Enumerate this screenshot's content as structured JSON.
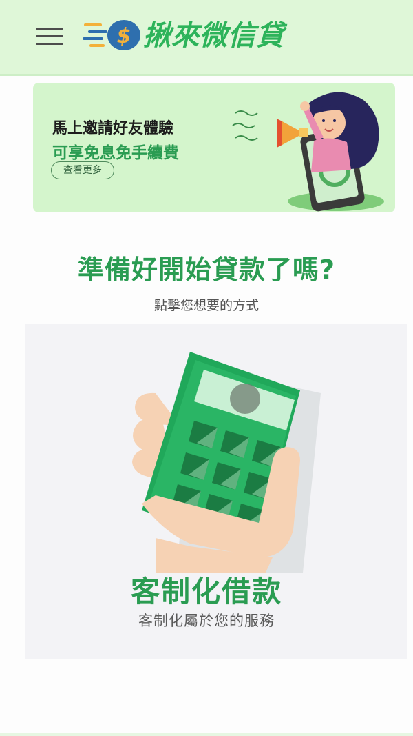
{
  "header": {
    "menu_icon": "hamburger-menu-icon",
    "logo_icon": "dollar-speed-icon",
    "logo_text": "揪來微信貸"
  },
  "banner": {
    "line1": "馬上邀請好友體驗",
    "line2": "可享免息免手續費",
    "more_label": "查看更多",
    "art": "woman-megaphone-phone-illustration"
  },
  "section": {
    "title": "準備好開始貸款了嗎?",
    "subtitle": "點擊您想要的方式"
  },
  "option": {
    "art": "hand-holding-calculator-illustration",
    "title": "客制化借款",
    "subtitle": "客制化屬於您的服務"
  },
  "colors": {
    "brand_green": "#2a9c52",
    "header_bg": "#dff7d8",
    "banner_bg": "#d4f5cc",
    "card_bg": "#f3f3f6"
  }
}
